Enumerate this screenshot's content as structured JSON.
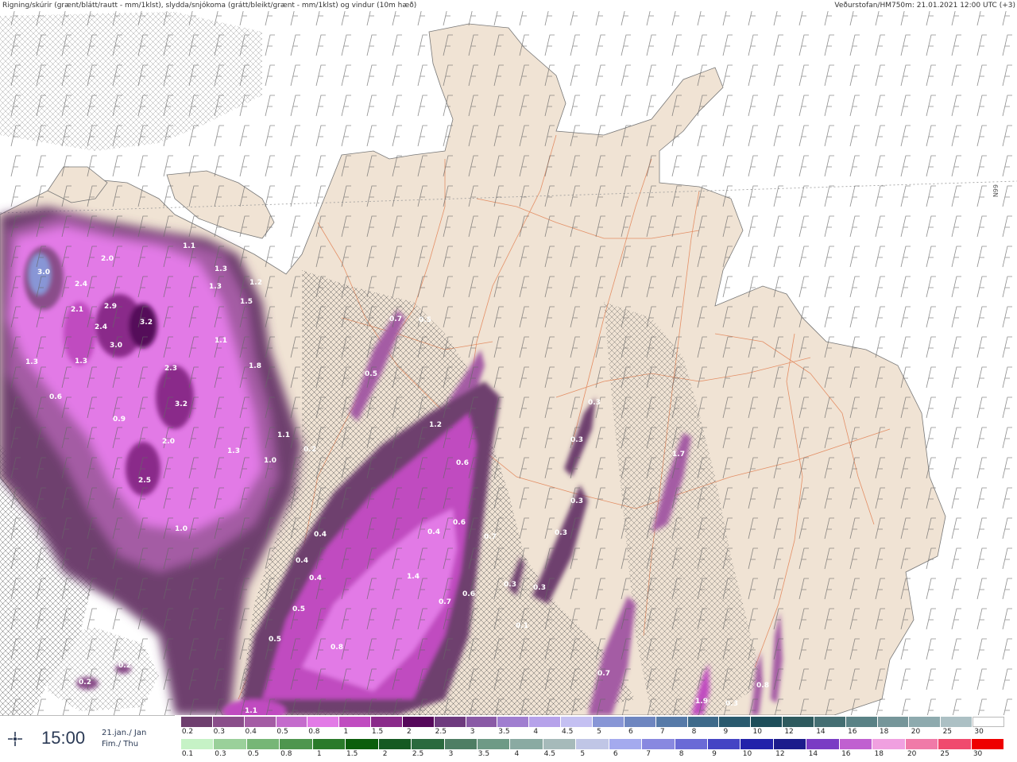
{
  "header": {
    "left_text": "Rigning/skúrir (grænt/blátt/rautt - mm/1klst), slydda/snjókoma (grátt/bleikt/grænt - mm/1klst) og vindur (10m hæð)",
    "right_text": "Veðurstofan/HM750m: 21.01.2021 12:00 UTC (+3)"
  },
  "time": {
    "icon": "map-pin-icon",
    "time": "15:00",
    "date_line1": "21.jan./ Jan",
    "date_line2": "Fim./ Thu"
  },
  "map": {
    "latitude_label": "66N",
    "colors": {
      "land": "#f0e3d4",
      "sea": "#ffffff",
      "roads": "#e07a4a"
    }
  },
  "legend": {
    "snow_labels": [
      "0.2",
      "0.3",
      "0.4",
      "0.5",
      "0.8",
      "1",
      "1.5",
      "2",
      "2.5",
      "3",
      "3.5",
      "4",
      "4.5",
      "5",
      "6",
      "7",
      "8",
      "9",
      "10",
      "12",
      "14",
      "16",
      "18",
      "20",
      "25",
      "30"
    ],
    "snow_colors": [
      "#6e3f6e",
      "#8a4e8a",
      "#a45ca4",
      "#c46ccc",
      "#e27ae6",
      "#c04cc0",
      "#8a2a8a",
      "#55085a",
      "#6e3a7e",
      "#8a5aa6",
      "#a07ed0",
      "#b6a2ea",
      "#c4c0f2",
      "#8896d6",
      "#6e86c0",
      "#567aa8",
      "#3e6a8a",
      "#2a5a6e",
      "#1e4e5a",
      "#2e5a5e",
      "#446e72",
      "#5a8286",
      "#76969a",
      "#8eaaae",
      "#acc0c4",
      "#ffffff"
    ],
    "rain_labels": [
      "0.1",
      "0.3",
      "0.5",
      "0.8",
      "1",
      "1.5",
      "2",
      "2.5",
      "3",
      "3.5",
      "4",
      "4.5",
      "5",
      "6",
      "7",
      "8",
      "9",
      "10",
      "12",
      "14",
      "16",
      "18",
      "20",
      "25",
      "30"
    ],
    "rain_colors": [
      "#c6f2c6",
      "#9ad09a",
      "#76b676",
      "#4e964e",
      "#2a7a2a",
      "#0c5e0c",
      "#155a22",
      "#2a6a3e",
      "#4e7e64",
      "#6e9a86",
      "#8aaaa2",
      "#a6baba",
      "#c0c6e6",
      "#a4aaee",
      "#8888e0",
      "#6a6ad6",
      "#4444c4",
      "#2222aa",
      "#1c1c8c",
      "#7a3cc4",
      "#c060d0",
      "#f0a0e0",
      "#f07aa8",
      "#f04a6e",
      "#ee0000"
    ]
  },
  "map_labels": [
    {
      "text": "3.0"
    },
    {
      "text": "2.0"
    },
    {
      "text": "2.4"
    },
    {
      "text": "2.1"
    },
    {
      "text": "2.9"
    },
    {
      "text": "2.4"
    },
    {
      "text": "3.2"
    },
    {
      "text": "3.0"
    },
    {
      "text": "1.3"
    },
    {
      "text": "1.3"
    },
    {
      "text": "0.6"
    },
    {
      "text": "0.9"
    },
    {
      "text": "2.3"
    },
    {
      "text": "3.2"
    },
    {
      "text": "2.0"
    },
    {
      "text": "1.3"
    },
    {
      "text": "2.5"
    },
    {
      "text": "1.0"
    },
    {
      "text": "1.1"
    },
    {
      "text": "1.3"
    },
    {
      "text": "1.3"
    },
    {
      "text": "1.2"
    },
    {
      "text": "1.5"
    },
    {
      "text": "1.1"
    },
    {
      "text": "1.8"
    },
    {
      "text": "1.1"
    },
    {
      "text": "1.0"
    },
    {
      "text": "0.2"
    },
    {
      "text": "0.4"
    },
    {
      "text": "0.4"
    },
    {
      "text": "0.4"
    },
    {
      "text": "0.5"
    },
    {
      "text": "0.5"
    },
    {
      "text": "0.8"
    },
    {
      "text": "1.4"
    },
    {
      "text": "0.7"
    },
    {
      "text": "0.4"
    },
    {
      "text": "0.6"
    },
    {
      "text": "0.7"
    },
    {
      "text": "0.6"
    },
    {
      "text": "0.6"
    },
    {
      "text": "1.2"
    },
    {
      "text": "0.5"
    },
    {
      "text": "0.7"
    },
    {
      "text": "0.5"
    },
    {
      "text": "0.3"
    },
    {
      "text": "0.3"
    },
    {
      "text": "0.3"
    },
    {
      "text": "0.3"
    },
    {
      "text": "0.3"
    },
    {
      "text": "0.3"
    },
    {
      "text": "0.1"
    },
    {
      "text": "1.7"
    },
    {
      "text": "0.7"
    },
    {
      "text": "0.2"
    },
    {
      "text": "0.2"
    },
    {
      "text": "1.1"
    },
    {
      "text": "1.9"
    },
    {
      "text": "0.3"
    },
    {
      "text": "0.8"
    }
  ]
}
